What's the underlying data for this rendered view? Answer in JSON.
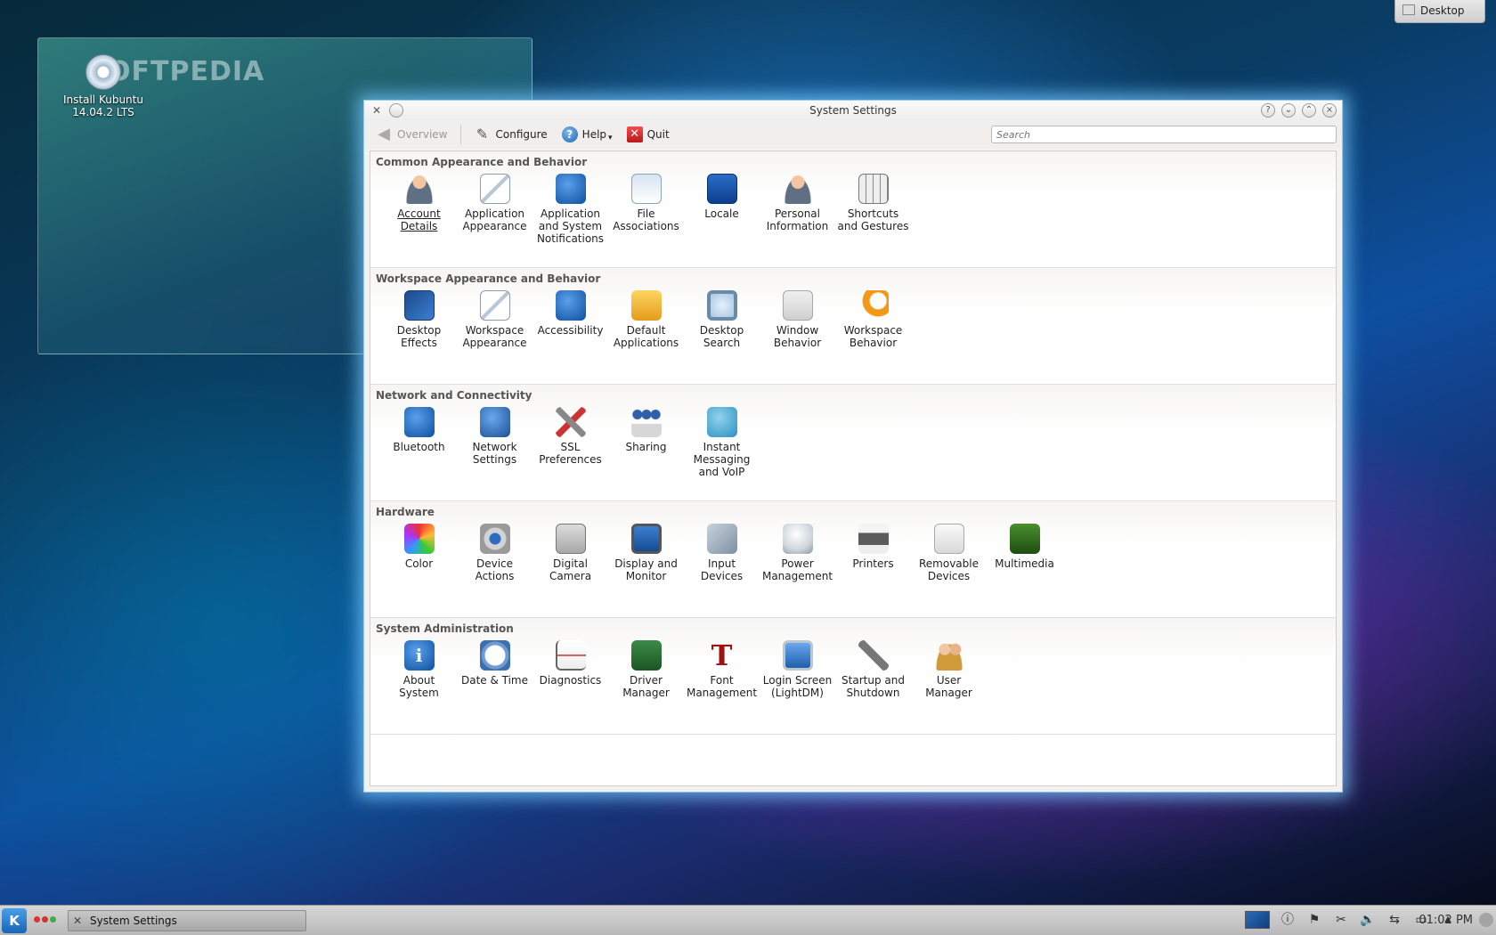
{
  "desktop": {
    "button_label": "Desktop",
    "icon_label_line1": "Install Kubuntu",
    "icon_label_line2": "14.04.2 LTS",
    "watermark": "OFTPEDIA"
  },
  "window": {
    "title": "System Settings",
    "toolbar": {
      "overview": "Overview",
      "configure": "Configure",
      "help": "Help",
      "quit": "Quit",
      "search_placeholder": "Search"
    },
    "sections": [
      {
        "title": "Common Appearance and Behavior",
        "items": [
          {
            "lines": [
              "Account",
              "Details"
            ],
            "icon": "account-icon",
            "style": "i-person"
          },
          {
            "lines": [
              "Application",
              "Appearance"
            ],
            "icon": "application-appearance-icon",
            "style": "i-window"
          },
          {
            "lines": [
              "Application",
              "and System",
              "Notifications"
            ],
            "icon": "notifications-icon",
            "style": "i-excl"
          },
          {
            "lines": [
              "File",
              "Associations"
            ],
            "icon": "file-associations-icon",
            "style": "i-files"
          },
          {
            "lines": [
              "Locale"
            ],
            "icon": "locale-flag-icon",
            "style": "i-flag"
          },
          {
            "lines": [
              "Personal",
              "Information"
            ],
            "icon": "personal-info-icon",
            "style": "i-person"
          },
          {
            "lines": [
              "Shortcuts",
              "and Gestures"
            ],
            "icon": "keyboard-icon",
            "style": "i-keys"
          }
        ]
      },
      {
        "title": "Workspace Appearance and Behavior",
        "items": [
          {
            "lines": [
              "Desktop",
              "Effects"
            ],
            "icon": "desktop-effects-icon",
            "style": "i-effects"
          },
          {
            "lines": [
              "Workspace",
              "Appearance"
            ],
            "icon": "workspace-appearance-icon",
            "style": "i-window"
          },
          {
            "lines": [
              "Accessibility"
            ],
            "icon": "accessibility-icon",
            "style": "i-access"
          },
          {
            "lines": [
              "Default",
              "Applications"
            ],
            "icon": "default-applications-icon",
            "style": "i-default"
          },
          {
            "lines": [
              "Desktop",
              "Search"
            ],
            "icon": "magnifier-icon",
            "style": "i-search"
          },
          {
            "lines": [
              "Window",
              "Behavior"
            ],
            "icon": "window-behavior-icon",
            "style": "i-winbeh"
          },
          {
            "lines": [
              "Workspace",
              "Behavior"
            ],
            "icon": "workspace-behavior-icon",
            "style": "i-moon"
          }
        ]
      },
      {
        "title": "Network and Connectivity",
        "items": [
          {
            "lines": [
              "Bluetooth"
            ],
            "icon": "bluetooth-icon",
            "style": "i-bt"
          },
          {
            "lines": [
              "Network",
              "Settings"
            ],
            "icon": "network-globe-icon",
            "style": "i-globe"
          },
          {
            "lines": [
              "SSL",
              "Preferences"
            ],
            "icon": "tools-icon",
            "style": "i-tools"
          },
          {
            "lines": [
              "Sharing"
            ],
            "icon": "sharing-icon",
            "style": "i-share"
          },
          {
            "lines": [
              "Instant",
              "Messaging",
              "and VoIP"
            ],
            "icon": "chat-bubble-icon",
            "style": "i-chat"
          }
        ]
      },
      {
        "title": "Hardware",
        "items": [
          {
            "lines": [
              "Color"
            ],
            "icon": "color-icon",
            "style": "i-color"
          },
          {
            "lines": [
              "Device",
              "Actions"
            ],
            "icon": "gear-icon",
            "style": "i-gear"
          },
          {
            "lines": [
              "Digital",
              "Camera"
            ],
            "icon": "camera-icon",
            "style": "i-camera"
          },
          {
            "lines": [
              "Display and",
              "Monitor"
            ],
            "icon": "monitor-icon",
            "style": "i-monitor"
          },
          {
            "lines": [
              "Input",
              "Devices"
            ],
            "icon": "input-devices-icon",
            "style": "i-input"
          },
          {
            "lines": [
              "Power",
              "Management"
            ],
            "icon": "lightbulb-icon",
            "style": "i-bulb"
          },
          {
            "lines": [
              "Printers"
            ],
            "icon": "printer-icon",
            "style": "i-printer"
          },
          {
            "lines": [
              "Removable",
              "Devices"
            ],
            "icon": "removable-drive-icon",
            "style": "i-removable"
          },
          {
            "lines": [
              "Multimedia"
            ],
            "icon": "multimedia-icon",
            "style": "i-media"
          }
        ]
      },
      {
        "title": "System Administration",
        "items": [
          {
            "lines": [
              "About",
              "System"
            ],
            "icon": "info-icon",
            "style": "i-info",
            "glyph": "i"
          },
          {
            "lines": [
              "Date & Time"
            ],
            "icon": "clock-icon",
            "style": "i-clock"
          },
          {
            "lines": [
              "Diagnostics"
            ],
            "icon": "diagnostics-chart-icon",
            "style": "i-diag"
          },
          {
            "lines": [
              "Driver",
              "Manager"
            ],
            "icon": "driver-board-icon",
            "style": "i-driver"
          },
          {
            "lines": [
              "Font",
              "Management"
            ],
            "icon": "font-icon",
            "style": "i-font",
            "glyph": "T"
          },
          {
            "lines": [
              "Login Screen",
              "(LightDM)"
            ],
            "icon": "login-screen-icon",
            "style": "i-login"
          },
          {
            "lines": [
              "Startup and",
              "Shutdown"
            ],
            "icon": "wrench-icon",
            "style": "i-wrench"
          },
          {
            "lines": [
              "User",
              "Manager"
            ],
            "icon": "users-icon",
            "style": "i-users"
          }
        ]
      }
    ]
  },
  "taskbar": {
    "task_label": "System Settings",
    "clock": "01:02 PM"
  }
}
